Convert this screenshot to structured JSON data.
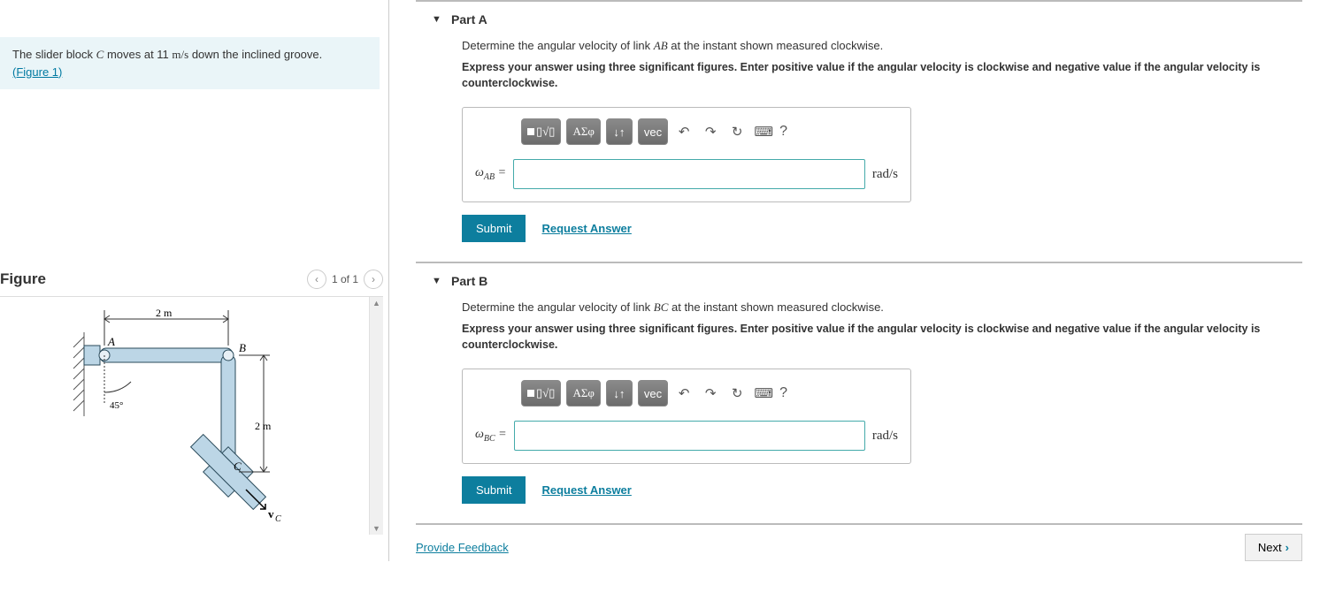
{
  "problem": {
    "text_prefix": "The slider block ",
    "var": "C",
    "text_mid": " moves at 11 ",
    "unit": "m/s",
    "text_suffix": " down the inclined groove.",
    "figure_link": "(Figure 1)"
  },
  "figure": {
    "title": "Figure",
    "pager": "1 of 1",
    "labels": {
      "A": "A",
      "B": "B",
      "C": "C",
      "vC": "vC",
      "len_AB": "2 m",
      "len_BC": "2 m",
      "angle": "45°"
    }
  },
  "parts": [
    {
      "title": "Part A",
      "prompt_pre": "Determine the angular velocity of link ",
      "prompt_var": "AB",
      "prompt_post": " at the instant shown measured clockwise.",
      "instruction": "Express your answer using three significant figures. Enter positive value if the angular velocity is clockwise and negative value if the angular velocity is counterclockwise.",
      "var_label": "ω",
      "var_sub": "AB",
      "equals": " =",
      "unit": "rad/s",
      "value": ""
    },
    {
      "title": "Part B",
      "prompt_pre": "Determine the angular velocity of link ",
      "prompt_var": "BC",
      "prompt_post": " at the instant shown measured clockwise.",
      "instruction": "Express your answer using three significant figures. Enter positive value if the angular velocity is clockwise and negative value if the angular velocity is counterclockwise.",
      "var_label": "ω",
      "var_sub": "BC",
      "equals": " =",
      "unit": "rad/s",
      "value": ""
    }
  ],
  "toolbar": {
    "templates": "▯√▯",
    "greek": "ΑΣφ",
    "subscript": "↓↑",
    "vec": "vec",
    "undo": "↶",
    "redo": "↷",
    "reset": "↻",
    "keyboard": "⌨",
    "help": "?"
  },
  "buttons": {
    "submit": "Submit",
    "request": "Request Answer",
    "feedback": "Provide Feedback",
    "next": "Next"
  }
}
